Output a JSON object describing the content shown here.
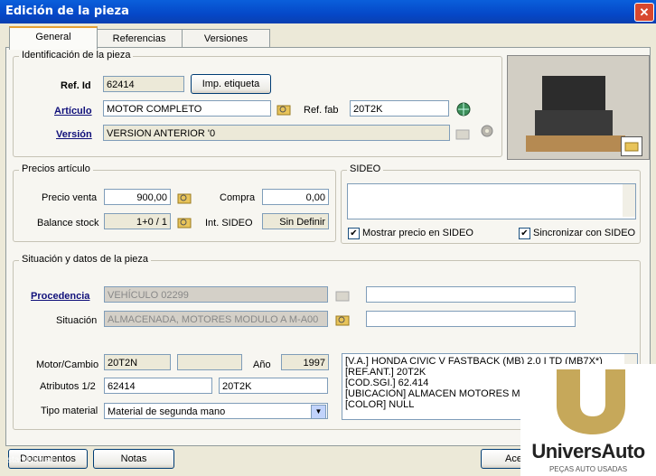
{
  "window": {
    "title": "Edición de la pieza"
  },
  "tabs": [
    "General",
    "Referencias",
    "Versiones"
  ],
  "identificacion": {
    "legend": "Identificación de la pieza",
    "ref_id_label": "Ref. Id",
    "ref_id_value": "62414",
    "imp_etiqueta": "Imp. etiqueta",
    "articulo_label": "Artículo",
    "articulo_value": "MOTOR COMPLETO",
    "ref_fab_label": "Ref. fab",
    "ref_fab_value": "20T2K",
    "version_label": "Versión",
    "version_value": "VERSION ANTERIOR '0"
  },
  "precios": {
    "legend": "Precios artículo",
    "precio_venta_label": "Precio venta",
    "precio_venta_value": "900,00",
    "compra_label": "Compra",
    "compra_value": "0,00",
    "balance_label": "Balance stock",
    "balance_value": "1+0 / 1",
    "int_sideo_label": "Int. SIDEO",
    "int_sideo_value": "Sin Definir"
  },
  "sideo": {
    "legend": "SIDEO",
    "mostrar_label": "Mostrar precio en SIDEO",
    "mostrar_checked": true,
    "sincronizar_label": "Sincronizar con SIDEO",
    "sincronizar_checked": true
  },
  "situacion": {
    "legend": "Situación y datos de la pieza",
    "procedencia_label": "Procedencia",
    "procedencia_value": "VEHÍCULO 02299",
    "situacion_label": "Situación",
    "situacion_value": "ALMACENADA, MOTORES MODULO A M-A00",
    "motor_label": "Motor/Cambio",
    "motor_value": "20T2N",
    "anio_label": "Año",
    "anio_value": "1997",
    "atributos_label": "Atributos 1/2",
    "atributo1": "62414",
    "atributo2": "20T2K",
    "tipo_label": "Tipo material",
    "tipo_value": "Material de segunda mano",
    "memo_lines": [
      "[V.A.] HONDA CIVIC V FASTBACK (MB) 2.0 I TD (MB7X*)",
      "[REF.ANT.] 20T2K",
      "[COD.SGI.] 62.414",
      "[UBICACION] ALMACEN MOTORES MOD",
      "[COLOR] NULL"
    ]
  },
  "footer": {
    "documentos": "Documentos",
    "notas": "Notas",
    "aceptar": "Ace"
  },
  "logo": {
    "brand": "UniversAuto",
    "tagline": "PEÇAS AUTO USADAS",
    "color": "#C6A85A"
  },
  "watermark": "standvirtual"
}
